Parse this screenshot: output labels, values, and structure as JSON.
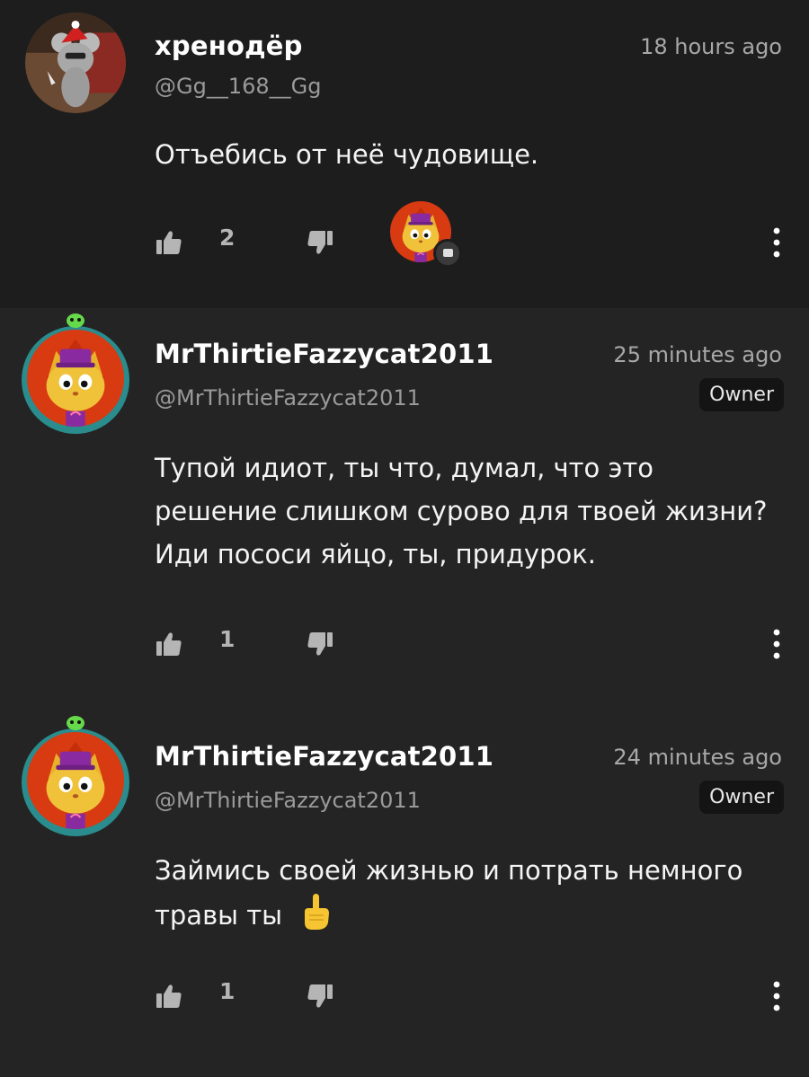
{
  "comments": [
    {
      "username": "хренодёр",
      "handle": "@Gg__168__Gg",
      "time": "18 hours ago",
      "text": "Отъебись от неё чудовище.",
      "likes": "2",
      "avatar_icon": "rat-avatar",
      "has_reply_avatar": true
    },
    {
      "username": "MrThirtieFazzycat2011",
      "handle": "@MrThirtieFazzycat2011",
      "time": "25 minutes ago",
      "badge": "Owner",
      "text": "Тупой идиот, ты что, думал, что это решение слишком сурово для твоей жизни? Иди пососи яйцо, ты, придурок.",
      "likes": "1",
      "avatar_icon": "cat-avatar"
    },
    {
      "username": "MrThirtieFazzycat2011",
      "handle": "@MrThirtieFazzycat2011",
      "time": "24 minutes ago",
      "badge": "Owner",
      "text": "Займись своей жизнью и потрать немного травы ты",
      "text_emoji": "pointing-up-emoji",
      "likes": "1",
      "avatar_icon": "cat-avatar"
    }
  ],
  "colors": {
    "background": "#232323",
    "first_comment_bg": "#1d1d1d",
    "muted_text": "#9a9a9a",
    "badge_bg": "#141414"
  }
}
